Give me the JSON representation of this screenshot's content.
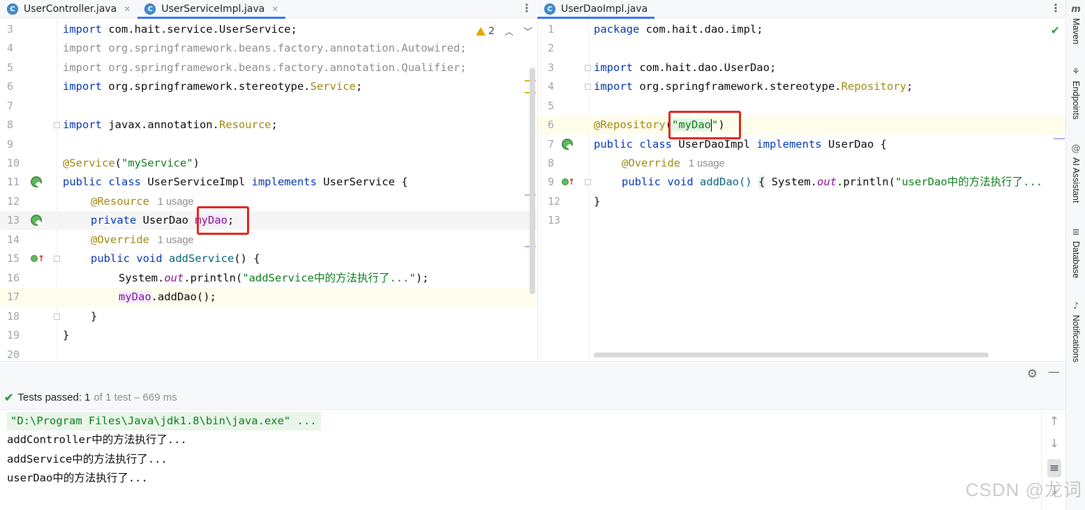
{
  "tabs_left": [
    {
      "label": "UserController.java",
      "icon": "C",
      "active": false
    },
    {
      "label": "UserServiceImpl.java",
      "icon": "C",
      "active": true
    }
  ],
  "tabs_right": [
    {
      "label": "UserDaoImpl.java",
      "icon": "C",
      "active": true
    }
  ],
  "left_editor": {
    "warning_count": "2",
    "lines": [
      {
        "num": "3"
      },
      {
        "num": "4"
      },
      {
        "num": "5"
      },
      {
        "num": "6"
      },
      {
        "num": "7"
      },
      {
        "num": "8"
      },
      {
        "num": "9"
      },
      {
        "num": "10"
      },
      {
        "num": "11"
      },
      {
        "num": "12"
      },
      {
        "num": "13"
      },
      {
        "num": "14"
      },
      {
        "num": "15"
      },
      {
        "num": "16"
      },
      {
        "num": "17"
      },
      {
        "num": "18"
      },
      {
        "num": "19"
      },
      {
        "num": "20"
      }
    ],
    "tok": {
      "l3a": "import",
      "l3b": " com.hait.service.UserService;",
      "l4": "import org.springframework.beans.factory.annotation.Autowired;",
      "l5": "import org.springframework.beans.factory.annotation.Qualifier;",
      "l6a": "import",
      "l6b": " org.springframework.stereotype.",
      "l6c": "Service",
      "l6d": ";",
      "l8a": "import",
      "l8b": " javax.annotation.",
      "l8c": "Resource",
      "l8d": ";",
      "l10a": "@Service",
      "l10b": "(",
      "l10c": "\"myService\"",
      "l10d": ")",
      "l11a": "public class",
      "l11b": " UserServiceImpl ",
      "l11c": "implements",
      "l11d": " UserService {",
      "l12a": "@Resource",
      "l12u": "1 usage",
      "l13a": "private",
      "l13b": " UserDao ",
      "l13c": "myDao",
      "l13d": ";",
      "l14a": "@Override",
      "l14u": "1 usage",
      "l15a": "public void",
      "l15b": " ",
      "l15c": "addService",
      "l15d": "() {",
      "l16a": "System.",
      "l16b": "out",
      "l16c": ".println(",
      "l16d": "\"addService中的方法执行了...\"",
      "l16e": ");",
      "l17a": "myDao",
      "l17b": ".addDao();",
      "l18": "}",
      "l19": "}"
    }
  },
  "right_editor": {
    "lines": [
      {
        "num": "1"
      },
      {
        "num": "2"
      },
      {
        "num": "3"
      },
      {
        "num": "4"
      },
      {
        "num": "5"
      },
      {
        "num": "6"
      },
      {
        "num": "7"
      },
      {
        "num": "8"
      },
      {
        "num": "9"
      },
      {
        "num": "12"
      },
      {
        "num": "13"
      }
    ],
    "tok": {
      "r1a": "package",
      "r1b": " com.hait.dao.impl;",
      "r3a": "import",
      "r3b": " com.hait.dao.UserDao;",
      "r4a": "import",
      "r4b": " org.springframework.stereotype.",
      "r4c": "Repository",
      "r4d": ";",
      "r6a": "@Repository",
      "r6b": "(",
      "r6c": "\"myDao",
      "r6d": "\"",
      "r6e": ")",
      "r7a": "public class",
      "r7b": " UserDaoImpl ",
      "r7c": "implements",
      "r7d": " UserDao {",
      "r8a": "@Override",
      "r8u": "1 usage",
      "r9a": "public void",
      "r9b": " addDao() ",
      "r9c": "{",
      "r9d": " System.",
      "r9e": "out",
      "r9f": ".println(",
      "r9g": "\"userDao中的方法执行了...",
      "r12": "}"
    }
  },
  "toolstrip": {
    "items": [
      {
        "label": "Maven",
        "icon": "m"
      },
      {
        "label": "Endpoints",
        "icon": "endpoints"
      },
      {
        "label": "AI Assistant",
        "icon": "ai"
      },
      {
        "label": "Database",
        "icon": "database"
      },
      {
        "label": "Notifications",
        "icon": "bell"
      }
    ]
  },
  "run_panel": {
    "status_label": "Tests passed:",
    "status_count": "1",
    "status_rest": "of 1 test – 669 ms",
    "console": [
      "\"D:\\Program Files\\Java\\jdk1.8\\bin\\java.exe\" ...",
      "addController中的方法执行了...",
      "addService中的方法执行了...",
      "userDao中的方法执行了..."
    ]
  },
  "watermark": "CSDN @龙词",
  "colors": {
    "keyword": "#0033b3",
    "annotation": "#9e880d",
    "string": "#067d17",
    "field": "#871094",
    "highlight_box": "#e1241b",
    "accent": "#3574f0"
  }
}
